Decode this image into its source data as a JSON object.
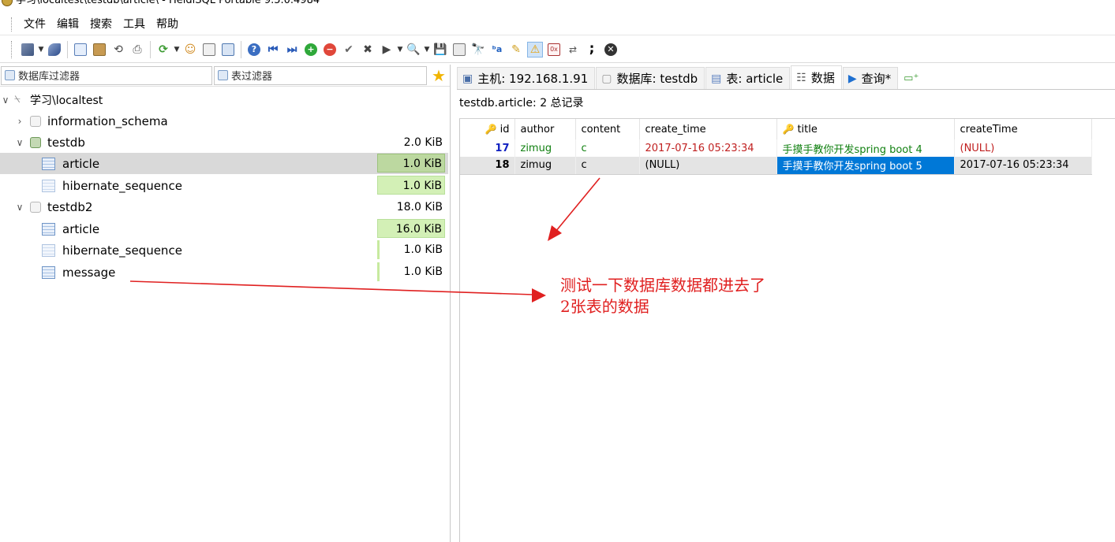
{
  "window": {
    "title": "学习\\localtest\\testdb\\article\\ - HeidiSQL Portable 9.5.0.4984"
  },
  "menu": [
    "文件",
    "编辑",
    "搜索",
    "工具",
    "帮助"
  ],
  "left": {
    "db_filter_placeholder": "数据库过滤器",
    "table_filter_placeholder": "表过滤器",
    "tree": [
      {
        "label": "学习\\localtest",
        "size": ""
      },
      {
        "label": "information_schema",
        "size": ""
      },
      {
        "label": "testdb",
        "size": "2.0 KiB"
      },
      {
        "label": "article",
        "size": "1.0 KiB"
      },
      {
        "label": "hibernate_sequence",
        "size": "1.0 KiB"
      },
      {
        "label": "testdb2",
        "size": "18.0 KiB"
      },
      {
        "label": "article",
        "size": "16.0 KiB"
      },
      {
        "label": "hibernate_sequence",
        "size": "1.0 KiB"
      },
      {
        "label": "message",
        "size": "1.0 KiB"
      }
    ]
  },
  "tabs": [
    {
      "label": "主机: 192.168.1.91",
      "icon": "host-icon"
    },
    {
      "label": "数据库: testdb",
      "icon": "database-icon"
    },
    {
      "label": "表: article",
      "icon": "table-icon"
    },
    {
      "label": "数据",
      "icon": "data-grid-icon"
    },
    {
      "label": "查询*",
      "icon": "play-icon"
    }
  ],
  "result": {
    "header": "testdb.article: 2 总记录",
    "columns": [
      "id",
      "author",
      "content",
      "create_time",
      "title",
      "createTime"
    ],
    "rows": [
      [
        "17",
        "zimug",
        "c",
        "2017-07-16 05:23:34",
        "手摸手教你开发spring boot 4",
        "(NULL)"
      ],
      [
        "18",
        "zimug",
        "c",
        "(NULL)",
        "手摸手教你开发spring boot 5",
        "2017-07-16 05:23:34"
      ]
    ]
  },
  "annotation": {
    "text": "测试一下数据库数据都进去了\n2张表的数据",
    "color": "#e02020"
  },
  "colors": {
    "selection": "#0078d7",
    "size_bar": "#d3f0b6"
  }
}
